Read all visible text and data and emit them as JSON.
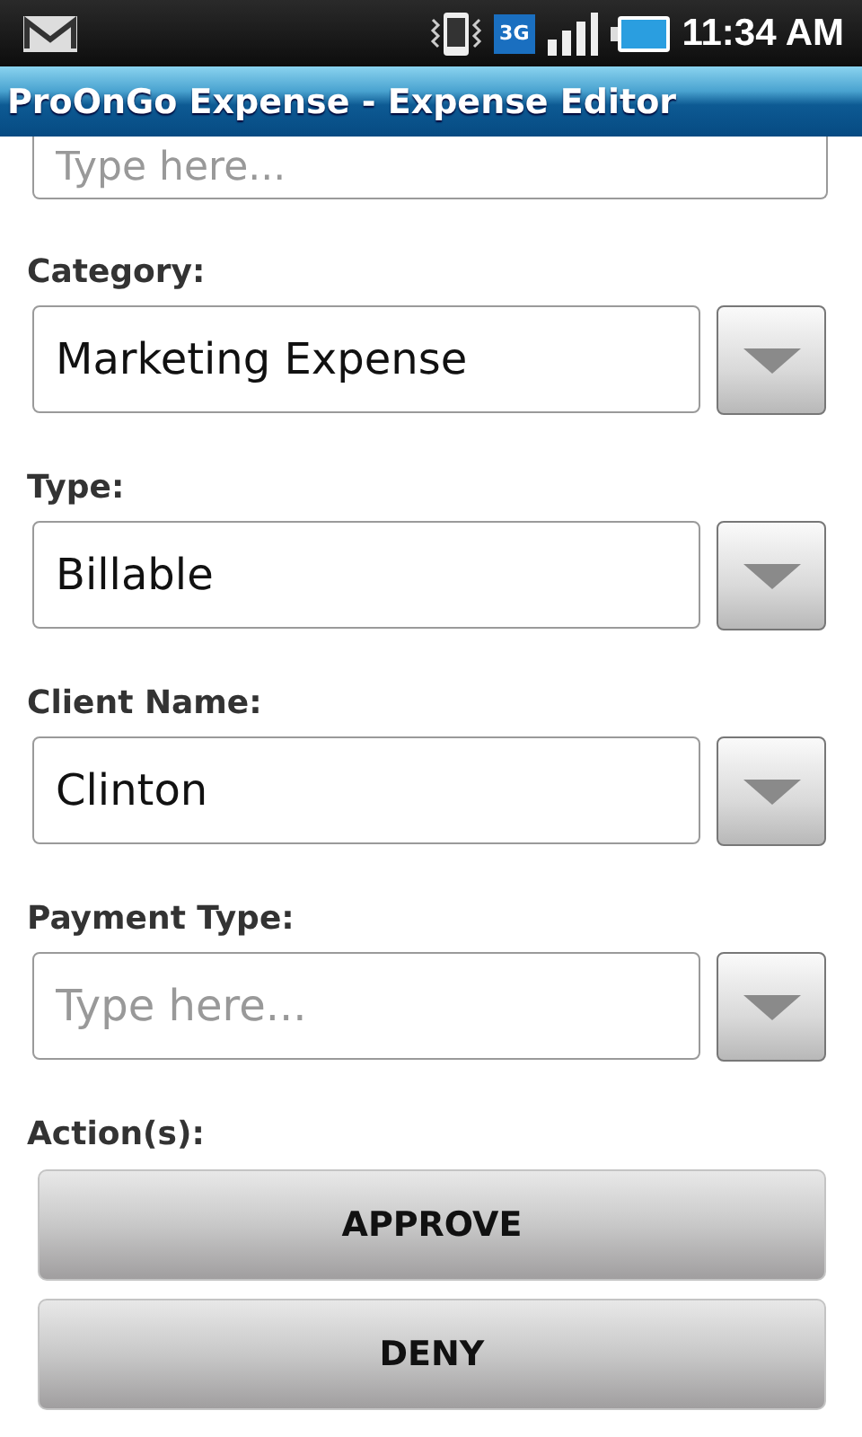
{
  "status_bar": {
    "time": "11:34 AM",
    "network": "3G"
  },
  "title": "ProOnGo Expense - Expense Editor",
  "top_field": {
    "placeholder": "Type here..."
  },
  "fields": [
    {
      "label": "Category:",
      "value": "Marketing Expense"
    },
    {
      "label": "Type:",
      "value": "Billable"
    },
    {
      "label": "Client Name:",
      "value": "Clinton"
    },
    {
      "label": "Payment Type:",
      "placeholder": "Type here..."
    }
  ],
  "actions": {
    "label": "Action(s):",
    "buttons": [
      "APPROVE",
      "DENY"
    ]
  }
}
